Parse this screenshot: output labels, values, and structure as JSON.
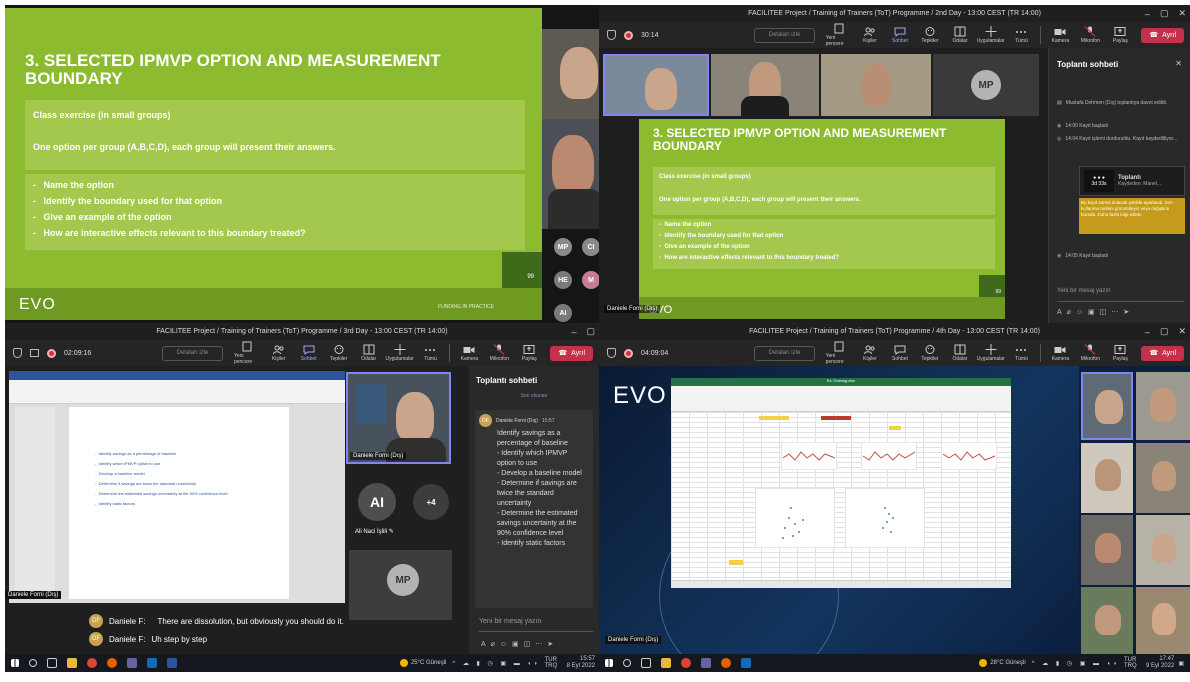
{
  "q1": {
    "slide": {
      "title": "3. SELECTED IPMVP OPTION AND MEASUREMENT BOUNDARY",
      "exercise": "Class exercise  (in small groups)",
      "instructions": "One option per group (A,B,C,D), each group will present their answers.",
      "bullets": [
        "Name the option",
        "Identify the boundary used for that option",
        "Give an example of the option",
        "How are interactive effects relevant to this boundary treated?"
      ],
      "logo": "EVO",
      "page": "99",
      "footer_tag": "FUNDING IN PRACTICE"
    },
    "avatars": [
      "MP",
      "CI",
      "HE",
      "M",
      "AI"
    ],
    "avatar_colors": [
      "#8a8a8a",
      "#8a8a8a",
      "#7a7a7a",
      "#c67c92",
      "#7a7a7a"
    ]
  },
  "q2": {
    "window_title": "FACILITEE Project / Training of Trainers (ToT) Programme / 2nd Day - 13:00 CEST (TR 14:00)",
    "timer": "30:14",
    "details": "Detaları izle",
    "toolbar": [
      {
        "label": "Yeni pencere",
        "icon": "new-window"
      },
      {
        "label": "Kişiler",
        "icon": "people"
      },
      {
        "label": "Sohbet",
        "icon": "chat",
        "active": true
      },
      {
        "label": "Tepkiler",
        "icon": "reactions"
      },
      {
        "label": "Odalar",
        "icon": "rooms"
      },
      {
        "label": "Uygulamalar",
        "icon": "apps"
      },
      {
        "label": "Tümü",
        "icon": "more"
      }
    ],
    "device": [
      {
        "label": "Kamera",
        "icon": "camera"
      },
      {
        "label": "Mikrofon",
        "icon": "mic"
      },
      {
        "label": "Paylaş",
        "icon": "share"
      }
    ],
    "leave": "Ayrıl",
    "avatar": "MP",
    "slide": {
      "title": "3. SELECTED IPMVP OPTION AND MEASUREMENT BOUNDARY",
      "exercise": "Class exercise  (in small groups)",
      "instructions": "One option per group (A,B,C,D), each group will present their answers.",
      "bullets": [
        "Name the option",
        "Identify the boundary used for that option",
        "Give an example of the option",
        "How are interactive effects relevant to this boundary treated?"
      ],
      "logo": "EVO",
      "page": "99"
    },
    "presenter": "Daniele Forni (Dış)",
    "chat": {
      "title": "Toplantı sohbeti",
      "events": [
        {
          "icon": "invite",
          "text": "Mustafa Dehmen (Dış) toplantıya davet edildi."
        },
        {
          "icon": "rec",
          "text": "14:00   Kayıt başladı"
        },
        {
          "icon": "stop",
          "text": "14:04   Kayıt işlemi durduruldu. Kayıt kaydedilliyor..."
        }
      ],
      "card": {
        "title": "Toplantı",
        "sub": "Kaydeden: Manel...",
        "duration": "3d 33s"
      },
      "notice": "Bu kayıt süresi dolacak şekilde ayarlandı. Son kullanma tarihini görüntüleyin veya değiştirin burada. Daha fazla bilgi edinin",
      "event2": "14:05   Kayıt başladı",
      "input_placeholder": "Yeni bir mesaj yazın"
    }
  },
  "q3": {
    "window_title": "FACILITEE Project / Training of Trainers (ToT) Programme / 3rd Day - 13:00 CEST (TR 14:00)",
    "timer": "02:09:16",
    "details": "Detaları izle",
    "toolbar": [
      {
        "label": "Yeni pencere",
        "icon": "new-window"
      },
      {
        "label": "Kişiler",
        "icon": "people"
      },
      {
        "label": "Sohbet",
        "icon": "chat",
        "active": true
      },
      {
        "label": "Tepkiler",
        "icon": "reactions"
      },
      {
        "label": "Odalar",
        "icon": "rooms"
      },
      {
        "label": "Uygulamalar",
        "icon": "apps"
      },
      {
        "label": "Tümü",
        "icon": "more"
      }
    ],
    "device": [
      {
        "label": "Kamera",
        "icon": "camera"
      },
      {
        "label": "Mikrofon",
        "icon": "mic"
      },
      {
        "label": "Paylaş",
        "icon": "share"
      }
    ],
    "leave": "Ayrıl",
    "doc_lines": [
      "Identify savings as a percentage of baseline",
      "Identify which IPMVP option to use",
      "Develop a baseline model",
      "Determine if savings are twice the standard uncertainty",
      "Determine the estimated savings uncertainty at the 90% confidence level",
      "Identify static factors"
    ],
    "speaker_tile": "Daniele Forni (Dış)",
    "avatar_ai": "AI",
    "avatar_ai_name": "Ali Naci İşlili",
    "more_count": "+4",
    "avatar_mp": "MP",
    "presenter": "Daniele Forni (Dış)",
    "captions": [
      {
        "badge": "DF",
        "speaker": "Daniele F:",
        "text": "There are dissolution, but obviously you should do it."
      },
      {
        "badge": "DF",
        "speaker": "Daniele F:",
        "text": "Uh step by step"
      }
    ],
    "chat": {
      "title": "Toplantı sohbeti",
      "link": "Son okunan",
      "badge": "DF",
      "sender": "Daniele Forni (Dış)",
      "time": "15:57",
      "message": "Identify savings as a percentage of baseline\n- Identify which IPMVP option to use\n- Develop a baseline model\n- Determine if savings are twice the standard uncertainty\n- Determine the estimated savings uncertainty at the 90% confidence level\n- Identify static factors",
      "input_placeholder": "Yeni bir mesaj yazın"
    },
    "taskbar": {
      "weather": "25°C Güneşli",
      "lang": "TUR TRQ",
      "time": "15:57",
      "date": "8 Eyl 2022"
    }
  },
  "q4": {
    "window_title": "FACILITEE Project / Training of Trainers (ToT) Programme / 4th Day - 13:00 CEST (TR 14:00)",
    "timer": "04:09:04",
    "details": "Detaları izle",
    "toolbar": [
      {
        "label": "Yeni pencere",
        "icon": "new-window"
      },
      {
        "label": "Kişiler",
        "icon": "people"
      },
      {
        "label": "Sohbet",
        "icon": "chat"
      },
      {
        "label": "Tepkiler",
        "icon": "reactions"
      },
      {
        "label": "Odalar",
        "icon": "rooms"
      },
      {
        "label": "Uygulamalar",
        "icon": "apps"
      },
      {
        "label": "Tümü",
        "icon": "more"
      }
    ],
    "device": [
      {
        "label": "Kamera",
        "icon": "camera"
      },
      {
        "label": "Mikrofon",
        "icon": "mic"
      },
      {
        "label": "Paylaş",
        "icon": "share"
      }
    ],
    "leave": "Ayrıl",
    "logo": "EVO",
    "excel_title": "Ex-Training.xlsx",
    "presenter": "Daniele Forni (Dış)",
    "taskbar": {
      "weather": "28°C Güneşli",
      "lang": "TUR TRQ",
      "time": "17:47",
      "date": "9 Eyl 2022"
    }
  }
}
